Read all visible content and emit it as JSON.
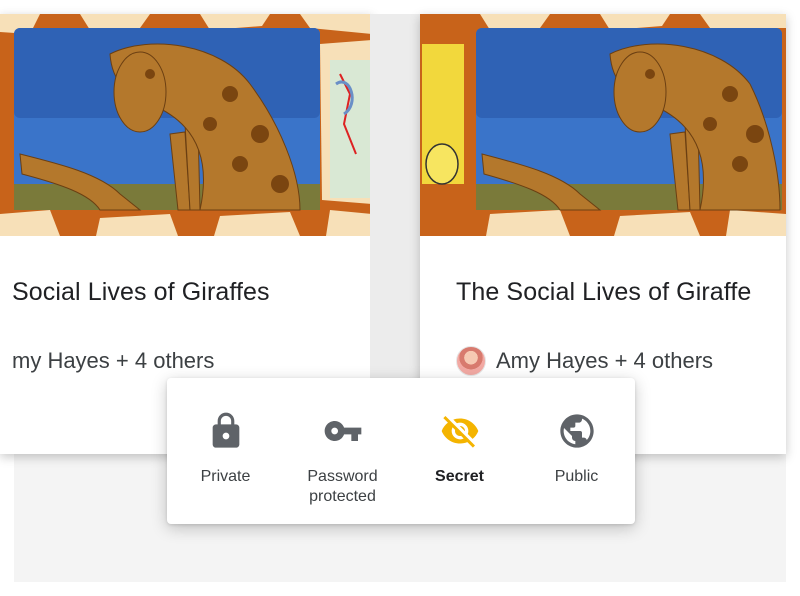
{
  "cards": [
    {
      "title": "Social Lives of Giraffes",
      "authors": "my Hayes + 4 others"
    },
    {
      "title": "The Social Lives of Giraffe",
      "authors": "Amy Hayes + 4 others"
    }
  ],
  "visibility_menu": {
    "selected": "secret",
    "options": [
      {
        "id": "private",
        "label": "Private",
        "icon": "lock-icon"
      },
      {
        "id": "password",
        "label": "Password protected",
        "icon": "key-icon"
      },
      {
        "id": "secret",
        "label": "Secret",
        "icon": "eye-off-icon"
      },
      {
        "id": "public",
        "label": "Public",
        "icon": "globe-icon"
      }
    ]
  },
  "colors": {
    "accent": "#f4b400",
    "icon": "#5f6368",
    "giraffe_pattern": "#c8631a"
  }
}
